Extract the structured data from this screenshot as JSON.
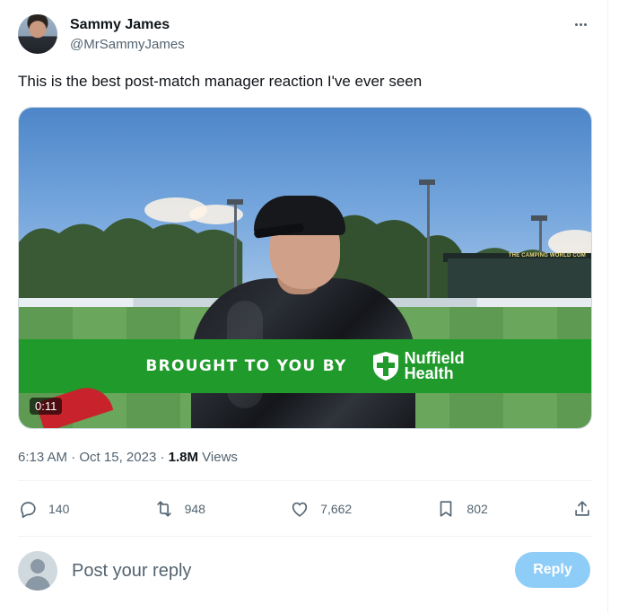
{
  "tweet": {
    "author": {
      "display_name": "Sammy James",
      "handle": "@MrSammyJames"
    },
    "text": "This is the best post-match manager reaction I've ever seen",
    "media": {
      "banner_text": "BROUGHT TO YOU BY",
      "sponsor_line1": "Nuffield",
      "sponsor_line2": "Health",
      "stand_sign": "THE CAMPING WORLD COM",
      "duration": "0:11",
      "banner_color": "#1f9a2b"
    },
    "meta": {
      "time": "6:13 AM",
      "separator": " · ",
      "date": "Oct 15, 2023",
      "separator2": " · ",
      "views_count": "1.8M",
      "views_label": " Views"
    },
    "actions": {
      "replies": "140",
      "reposts": "948",
      "likes": "7,662",
      "bookmarks": "802",
      "icons": [
        "reply-icon",
        "repost-icon",
        "like-icon",
        "bookmark-icon",
        "share-icon"
      ]
    }
  },
  "reply_box": {
    "placeholder": "Post your reply",
    "button_label": "Reply",
    "button_color": "#8ecdf8"
  }
}
